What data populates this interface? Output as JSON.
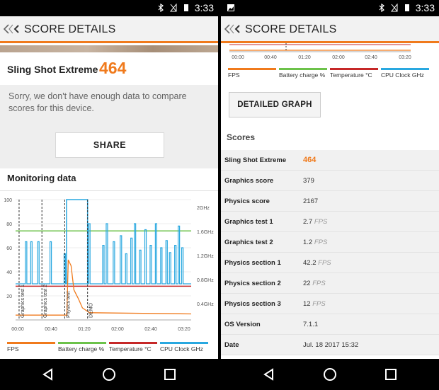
{
  "status": {
    "time": "3:33"
  },
  "app": {
    "title": "SCORE DETAILS"
  },
  "left": {
    "test_name": "Sling Shot Extreme",
    "score": "464",
    "message": "Sorry, we don't have enough data to compare scores for this device.",
    "share_label": "SHARE",
    "monitoring_title": "Monitoring data"
  },
  "chart_data": {
    "type": "line",
    "y_left_ticks": [
      "100",
      "80",
      "60",
      "40",
      "20"
    ],
    "y_right_ticks": [
      "2GHz",
      "1.6GHz",
      "1.2GHz",
      "0.8GHz",
      "0.4GHz"
    ],
    "x_ticks": [
      "00:00",
      "00:40",
      "01:20",
      "02:00",
      "02:40",
      "03:20"
    ],
    "markers": [
      "Graphics test 1",
      "Graphics test 2",
      "Physics test",
      "DEMO"
    ],
    "legend": [
      "FPS",
      "Battery charge %",
      "Temperature °C",
      "CPU Clock GHz"
    ],
    "colors": {
      "fps": "#f07a1c",
      "battery": "#6cc24a",
      "temperature": "#c62828",
      "cpu": "#29a8e0"
    },
    "ylim": [
      0,
      100
    ],
    "battery_level": 74,
    "temperature_level": 28,
    "demo_label": "DEMO"
  },
  "right": {
    "legend": [
      "FPS",
      "Battery charge %",
      "Temperature °C",
      "CPU Clock GHz"
    ],
    "x_ticks": [
      "00:00",
      "00:40",
      "01:20",
      "02:00",
      "02:40",
      "03:20"
    ],
    "detailed_label": "DETAILED GRAPH",
    "scores_title": "Scores",
    "rows": [
      {
        "k": "Sling Shot Extreme",
        "v": "464",
        "u": ""
      },
      {
        "k": "Graphics score",
        "v": "379",
        "u": ""
      },
      {
        "k": "Physics score",
        "v": "2167",
        "u": ""
      },
      {
        "k": "Graphics test 1",
        "v": "2.7",
        "u": "FPS"
      },
      {
        "k": "Graphics test 2",
        "v": "1.2",
        "u": "FPS"
      },
      {
        "k": "Physics section 1",
        "v": "42.2",
        "u": "FPS"
      },
      {
        "k": "Physics section 2",
        "v": "22",
        "u": "FPS"
      },
      {
        "k": "Physics section 3",
        "v": "12",
        "u": "FPS"
      },
      {
        "k": "OS Version",
        "v": "7.1.1",
        "u": ""
      },
      {
        "k": "Date",
        "v": "Jul. 18 2017 15:32",
        "u": ""
      }
    ]
  }
}
